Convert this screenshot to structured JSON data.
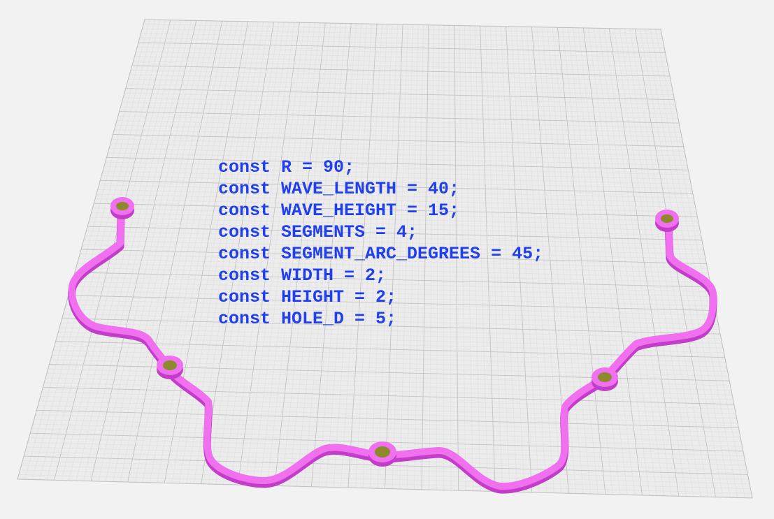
{
  "code_lines": [
    "const R = 90;",
    "const WAVE_LENGTH = 40;",
    "const WAVE_HEIGHT = 15;",
    "const SEGMENTS = 4;",
    "const SEGMENT_ARC_DEGREES = 45;",
    "const WIDTH = 2;",
    "const HEIGHT = 2;",
    "const HOLE_D = 5;"
  ],
  "colors": {
    "background": "#f2f2f2",
    "grid_plane": "#ececec",
    "grid_minor": "#dcdcdc",
    "grid_major": "#c4c4c4",
    "code_text": "#1f3ff0",
    "model_top": "#f070f0",
    "model_side": "#c23ec8",
    "hole_interior": "#8c8a2a"
  }
}
